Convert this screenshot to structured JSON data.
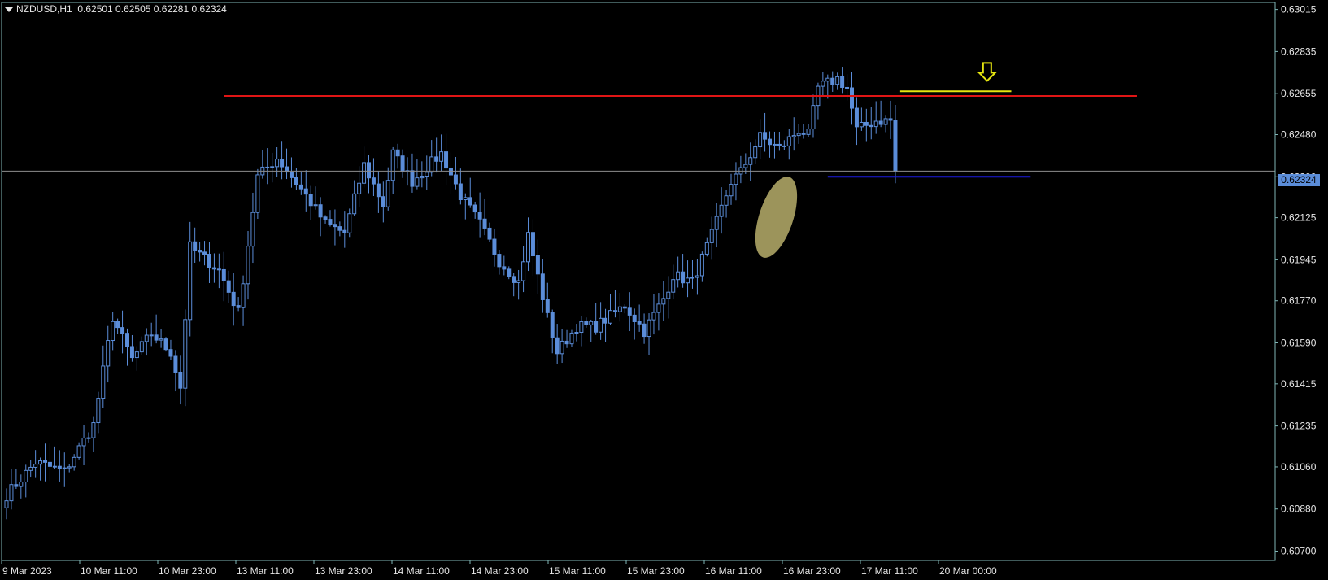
{
  "header": {
    "symbol": "NZDUSD,H1",
    "ohlc": "0.62501 0.62505 0.62281 0.62324"
  },
  "current_price_label": "0.62324",
  "colors": {
    "background": "#000000",
    "frame": "#7fb6b6",
    "text": "#e6e6e6",
    "candle": "#5b8dd9",
    "candle_dark": "#2a52d6",
    "resistance": "#e01515",
    "entry_line": "#e5e510",
    "support": "#1a1ae0",
    "bid_line": "#8e8e8e",
    "highlight": "#d8cd7e"
  },
  "icons": [
    "dropdown-triangle-icon",
    "sell-arrow-icon"
  ],
  "chart_data": {
    "type": "candlestick",
    "title": "NZDUSD,H1",
    "x_ticks": [
      "9 Mar 2023",
      "10 Mar 11:00",
      "10 Mar 23:00",
      "13 Mar 11:00",
      "13 Mar 23:00",
      "14 Mar 11:00",
      "14 Mar 23:00",
      "15 Mar 11:00",
      "15 Mar 23:00",
      "16 Mar 11:00",
      "16 Mar 23:00",
      "17 Mar 11:00",
      "20 Mar 00:00"
    ],
    "y_ticks": [
      "0.63015",
      "0.62835",
      "0.62655",
      "0.62480",
      "0.62300",
      "0.62125",
      "0.61945",
      "0.61770",
      "0.61590",
      "0.61415",
      "0.61235",
      "0.61060",
      "0.60880",
      "0.60700"
    ],
    "ylim": [
      0.6066,
      0.63045
    ],
    "grid": false,
    "current_price": 0.62324,
    "close_anchors": [
      [
        0,
        0.6094
      ],
      [
        6,
        0.6108
      ],
      [
        12,
        0.6104
      ],
      [
        18,
        0.6124
      ],
      [
        22,
        0.617
      ],
      [
        26,
        0.6152
      ],
      [
        30,
        0.6163
      ],
      [
        34,
        0.6155
      ],
      [
        36,
        0.614
      ],
      [
        38,
        0.62
      ],
      [
        44,
        0.619
      ],
      [
        48,
        0.6172
      ],
      [
        52,
        0.623
      ],
      [
        56,
        0.6238
      ],
      [
        62,
        0.6222
      ],
      [
        66,
        0.621
      ],
      [
        70,
        0.6206
      ],
      [
        74,
        0.6235
      ],
      [
        78,
        0.6218
      ],
      [
        80,
        0.624
      ],
      [
        84,
        0.6228
      ],
      [
        90,
        0.624
      ],
      [
        94,
        0.6222
      ],
      [
        98,
        0.621
      ],
      [
        102,
        0.6194
      ],
      [
        106,
        0.6185
      ],
      [
        108,
        0.6205
      ],
      [
        112,
        0.617
      ],
      [
        114,
        0.6155
      ],
      [
        118,
        0.6166
      ],
      [
        122,
        0.6166
      ],
      [
        128,
        0.6175
      ],
      [
        132,
        0.6164
      ],
      [
        136,
        0.6178
      ],
      [
        138,
        0.6188
      ],
      [
        142,
        0.6185
      ],
      [
        144,
        0.6195
      ],
      [
        146,
        0.6205
      ],
      [
        150,
        0.6228
      ],
      [
        152,
        0.6232
      ],
      [
        156,
        0.6247
      ],
      [
        160,
        0.6242
      ],
      [
        164,
        0.625
      ],
      [
        166,
        0.6248
      ],
      [
        168,
        0.6268
      ],
      [
        172,
        0.6272
      ],
      [
        174,
        0.6268
      ],
      [
        176,
        0.625
      ],
      [
        180,
        0.6254
      ],
      [
        183,
        0.6254
      ],
      [
        184,
        0.6232
      ]
    ],
    "annotations": [
      {
        "kind": "resistance",
        "price": 0.62645,
        "from_bar": 45,
        "to_bar": 234
      },
      {
        "kind": "entry",
        "price": 0.62665,
        "from_bar": 185,
        "to_bar": 208
      },
      {
        "kind": "support",
        "price": 0.623,
        "from_bar": 170,
        "to_bar": 212
      },
      {
        "kind": "bid",
        "price": 0.62324
      },
      {
        "kind": "sell-arrow",
        "bar": 203,
        "price": 0.6271
      },
      {
        "kind": "highlight-ellipse",
        "from_bar": 154,
        "to_bar": 164
      }
    ]
  }
}
